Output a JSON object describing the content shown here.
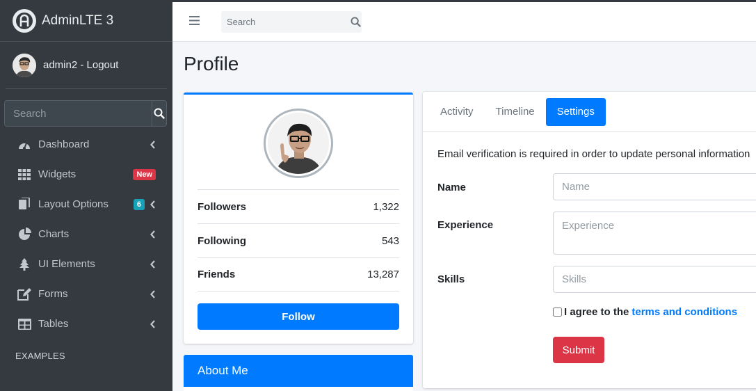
{
  "sidebar": {
    "brand": "AdminLTE 3",
    "user": "admin2 - Logout",
    "search_placeholder": "Search",
    "items": [
      {
        "label": "Dashboard",
        "icon": "tachometer-icon"
      },
      {
        "label": "Widgets",
        "icon": "grid-icon",
        "badge": "New",
        "badge_color": "#dc3545"
      },
      {
        "label": "Layout Options",
        "icon": "copy-icon",
        "badge": "6",
        "badge_color": "#17a2b8"
      },
      {
        "label": "Charts",
        "icon": "pie-chart-icon"
      },
      {
        "label": "UI Elements",
        "icon": "tree-icon"
      },
      {
        "label": "Forms",
        "icon": "edit-icon"
      },
      {
        "label": "Tables",
        "icon": "table-icon"
      }
    ],
    "section_header": "EXAMPLES"
  },
  "navbar": {
    "search_placeholder": "Search"
  },
  "page_title": "Profile",
  "profile": {
    "stats": [
      {
        "label": "Followers",
        "value": "1,322"
      },
      {
        "label": "Following",
        "value": "543"
      },
      {
        "label": "Friends",
        "value": "13,287"
      }
    ],
    "follow_label": "Follow",
    "about_title": "About Me"
  },
  "settings": {
    "tabs": [
      "Activity",
      "Timeline",
      "Settings"
    ],
    "active_tab": "Settings",
    "notice": "Email verification is required in order to update personal information",
    "name_label": "Name",
    "name_placeholder": "Name",
    "experience_label": "Experience",
    "experience_placeholder": "Experience",
    "skills_label": "Skills",
    "skills_placeholder": "Skills",
    "agree_text": "I agree to the",
    "terms_link": "terms and conditions",
    "submit_label": "Submit"
  },
  "colors": {
    "primary": "#007bff",
    "danger": "#dc3545",
    "info": "#17a2b8",
    "sidebar_bg": "#343a40"
  }
}
